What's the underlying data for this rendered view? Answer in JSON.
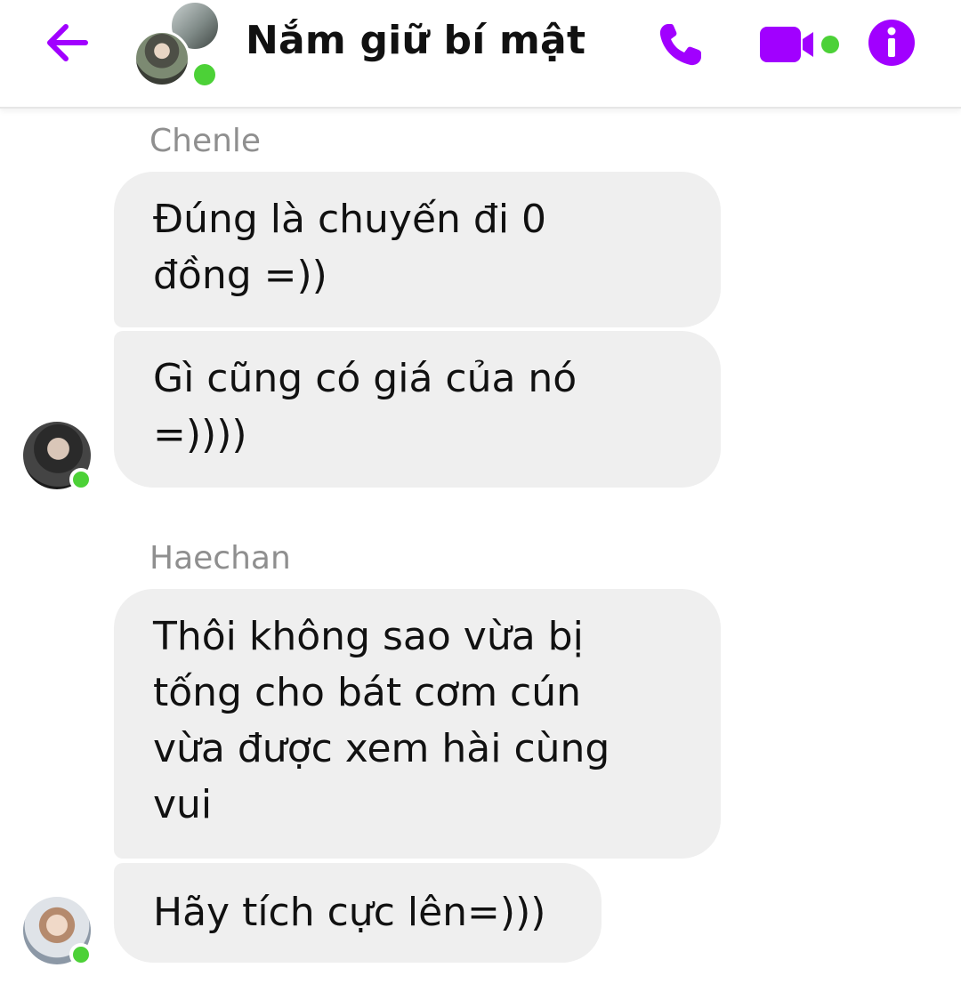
{
  "header": {
    "title": "Nắm giữ bí mật",
    "accent_color": "#a100ff",
    "online_color": "#4cd137",
    "icons": {
      "back": "back-arrow-icon",
      "call": "phone-icon",
      "video": "video-camera-icon",
      "info": "info-icon"
    }
  },
  "conversation": {
    "groups": [
      {
        "sender": "Chenle",
        "messages": [
          "Đúng là chuyến đi 0\nđồng =))",
          "Gì cũng có giá của nó\n=))))"
        ]
      },
      {
        "sender": "Haechan",
        "messages": [
          "Thôi không sao vừa bị\ntống cho bát cơm cún\nvừa được xem hài cùng\nvui",
          "Hãy tích cực lên=)))"
        ]
      }
    ]
  }
}
